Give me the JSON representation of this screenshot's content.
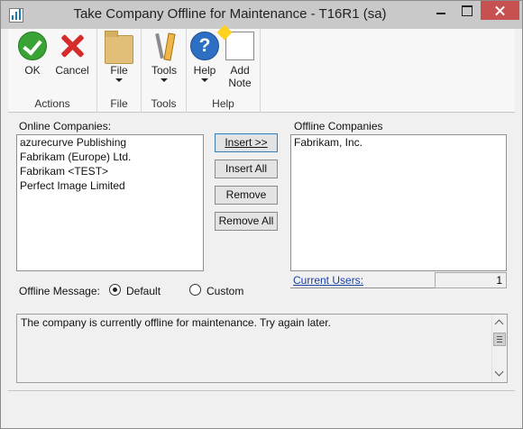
{
  "window": {
    "title": "Take Company Offline for Maintenance  -  T16R1 (sa)",
    "app_icon": "chart-icon",
    "controls": [
      "minimize-icon",
      "maximize-icon",
      "close-icon"
    ]
  },
  "ribbon": {
    "groups": [
      {
        "name": "Actions",
        "buttons": [
          {
            "label": "OK",
            "icon": "check-icon"
          },
          {
            "label": "Cancel",
            "icon": "x-icon"
          }
        ]
      },
      {
        "name": "File",
        "buttons": [
          {
            "label": "File",
            "icon": "folder-icon",
            "dropdown": true
          }
        ]
      },
      {
        "name": "Tools",
        "buttons": [
          {
            "label": "Tools",
            "icon": "tools-icon",
            "dropdown": true
          }
        ]
      },
      {
        "name": "Help",
        "buttons": [
          {
            "label": "Help",
            "icon": "help-icon",
            "dropdown": true
          },
          {
            "label": "Add Note",
            "icon": "note-icon"
          }
        ]
      }
    ],
    "help_glyph": "?"
  },
  "online": {
    "label": "Online Companies:",
    "items": [
      "azurecurve Publishing",
      "Fabrikam (Europe) Ltd.",
      "Fabrikam <TEST>",
      "Perfect Image Limited"
    ]
  },
  "offline": {
    "label": "Offline Companies",
    "items": [
      "Fabrikam, Inc."
    ]
  },
  "buttons": {
    "insert": "Insert >>",
    "insert_all": "Insert All",
    "remove": "Remove",
    "remove_all": "Remove All"
  },
  "offline_message": {
    "label": "Offline Message:",
    "options": [
      "Default",
      "Custom"
    ],
    "selected": "Default",
    "text": "The company is currently offline for maintenance. Try again later."
  },
  "current_users": {
    "label": "Current Users:",
    "count": "1"
  },
  "colors": {
    "title_bar": "#c9c9c9",
    "close_button": "#c75050",
    "link": "#1a3fa5",
    "ok_green": "#3aa335",
    "cancel_red": "#d52b2b",
    "help_blue": "#2d6fc2"
  }
}
